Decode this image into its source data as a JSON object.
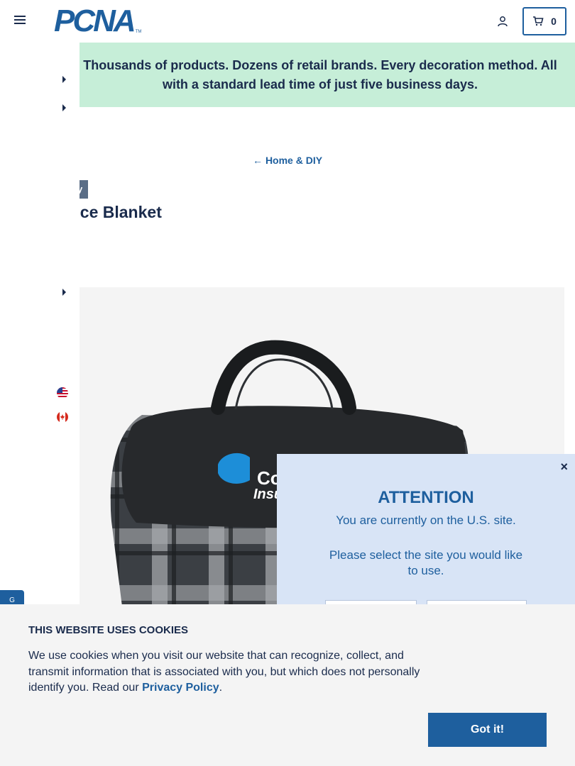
{
  "header": {
    "logo_text": "PCNA",
    "logo_tm": "TM",
    "cart_count": "0"
  },
  "banner": {
    "text": "Thousands of products. Dozens of retail brands. Every decoration method. All with a standard lead time of just five business days."
  },
  "breadcrumb": {
    "arrow": "←",
    "label": "Home & DIY"
  },
  "product": {
    "tag": "ry",
    "title": "ece Blanket",
    "logo_text_1": "Co",
    "logo_text_2": "Insu"
  },
  "modal": {
    "close": "×",
    "title": "ATTENTION",
    "line1": "You are currently on the U.S. site.",
    "line2": "Please select the site you would like to use."
  },
  "side_tab": {
    "label": "G"
  },
  "cookie": {
    "title": "THIS WEBSITE USES COOKIES",
    "body": "We use cookies when you visit our website that can recognize, collect, and transmit information that is associated with you, but which does not personally identify you. Read our ",
    "link": "Privacy Policy",
    "period": ".",
    "button": "Got it!"
  },
  "colors": {
    "brand_blue": "#1e5f9e",
    "navy": "#1a2b4c",
    "banner_green": "#c6eed8",
    "modal_bg": "#d8e4f6"
  }
}
